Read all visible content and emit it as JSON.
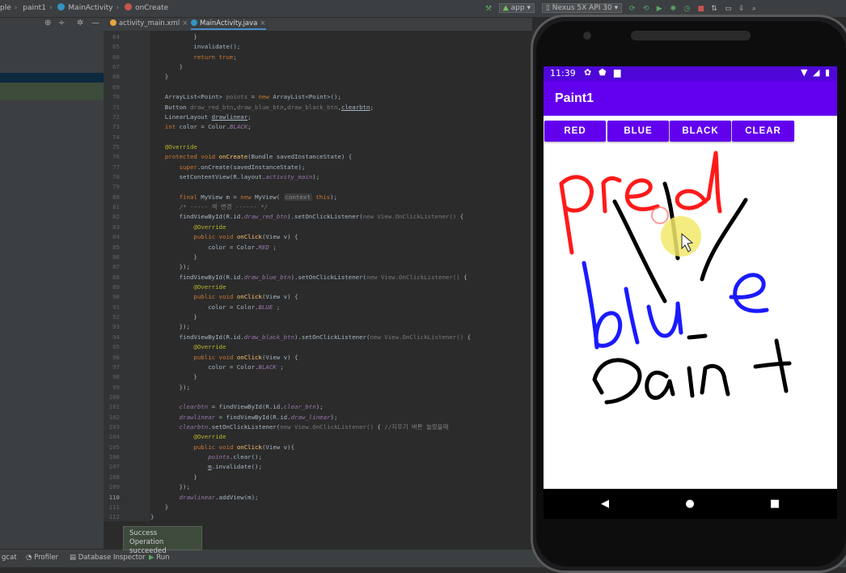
{
  "breadcrumbs": [
    {
      "label": "ple"
    },
    {
      "label": "paint1"
    },
    {
      "label": "MainActivity"
    },
    {
      "label": "onCreate"
    }
  ],
  "toolbar": {
    "run_config": "app",
    "device": "Nexus 5X API 30"
  },
  "tabs": [
    {
      "label": "activity_main.xml"
    },
    {
      "label": "MainActivity.java"
    }
  ],
  "code_lines": [
    {
      "n": "64",
      "html": "            }"
    },
    {
      "n": "65",
      "html": "            invalidate();"
    },
    {
      "n": "66",
      "html": "            <span class=\"kw\">return true</span>;"
    },
    {
      "n": "67",
      "html": "        }"
    },
    {
      "n": "68",
      "html": "    }"
    },
    {
      "n": "69",
      "html": ""
    },
    {
      "n": "70",
      "html": "    ArrayList&lt;Point&gt; <span class=\"gray\">points</span> = <span class=\"kw\">new</span> ArrayList&lt;Point&gt;();"
    },
    {
      "n": "71",
      "html": "    Button <span class=\"gray\">draw_red_btn</span>,<span class=\"gray\">draw_blue_btn</span>,<span class=\"gray\">draw_black_btn</span>,<span class=\"ul\">clearbtn</span>;"
    },
    {
      "n": "72",
      "html": "    LinearLayout <span class=\"ul\">drawlinear</span>;"
    },
    {
      "n": "73",
      "html": "    <span class=\"kw\">int</span> color = Color.<span class=\"it\">BLACK</span>;"
    },
    {
      "n": "74",
      "html": ""
    },
    {
      "n": "75",
      "html": "    <span class=\"ann\">@Override</span>"
    },
    {
      "n": "76",
      "html": "    <span class=\"kw\">protected void</span> <span class=\"fn\">onCreate</span>(Bundle savedInstanceState) {"
    },
    {
      "n": "77",
      "html": "        <span class=\"kw\">super</span>.onCreate(savedInstanceState);"
    },
    {
      "n": "78",
      "html": "        setContentView(R.layout.<span class=\"it\">activity_main</span>);"
    },
    {
      "n": "79",
      "html": ""
    },
    {
      "n": "80",
      "html": "        <span class=\"kw\">final</span> MyView m = <span class=\"kw\">new</span> MyView( <span class=\"hint\">context</span> <span class=\"kw\">this</span>);"
    },
    {
      "n": "81",
      "html": "        <span class=\"cm\">/* ----- 색 변경 ------ */</span>"
    },
    {
      "n": "82",
      "html": "        findViewById(R.id.<span class=\"it\">draw_red_btn</span>).setOnClickListener(<span class=\"gray\">new View.OnClickListener()</span> {"
    },
    {
      "n": "83",
      "html": "            <span class=\"ann\">@Override</span>"
    },
    {
      "n": "84",
      "html": "            <span class=\"kw\">public void</span> <span class=\"fn\">onClick</span>(View v) {"
    },
    {
      "n": "85",
      "html": "                color = Color.<span class=\"it\">RED</span> ;"
    },
    {
      "n": "86",
      "html": "            }"
    },
    {
      "n": "87",
      "html": "        });"
    },
    {
      "n": "88",
      "html": "        findViewById(R.id.<span class=\"it\">draw_blue_btn</span>).setOnClickListener(<span class=\"gray\">new View.OnClickListener()</span> {"
    },
    {
      "n": "89",
      "html": "            <span class=\"ann\">@Override</span>"
    },
    {
      "n": "90",
      "html": "            <span class=\"kw\">public void</span> <span class=\"fn\">onClick</span>(View v) {"
    },
    {
      "n": "91",
      "html": "                color = Color.<span class=\"it\">BLUE</span> ;"
    },
    {
      "n": "92",
      "html": "            }"
    },
    {
      "n": "93",
      "html": "        });"
    },
    {
      "n": "94",
      "html": "        findViewById(R.id.<span class=\"it\">draw_black_btn</span>).setOnClickListener(<span class=\"gray\">new View.OnClickListener()</span> {"
    },
    {
      "n": "95",
      "html": "            <span class=\"ann\">@Override</span>"
    },
    {
      "n": "96",
      "html": "            <span class=\"kw\">public void</span> <span class=\"fn\">onClick</span>(View v) {"
    },
    {
      "n": "97",
      "html": "                color = Color.<span class=\"it\">BLACK</span> ;"
    },
    {
      "n": "98",
      "html": "            }"
    },
    {
      "n": "99",
      "html": "        });"
    },
    {
      "n": "100",
      "html": ""
    },
    {
      "n": "101",
      "html": "        <span class=\"it\">clearbtn</span> = findViewById(R.id.<span class=\"it\">clear_btn</span>);"
    },
    {
      "n": "102",
      "html": "        <span class=\"it\">drawlinear</span> = findViewById(R.id.<span class=\"it\">draw_linear</span>);"
    },
    {
      "n": "103",
      "html": "        <span class=\"it\">clearbtn</span>.setOnClickListener(<span class=\"gray\">new View.OnClickListener()</span> { <span class=\"cm\">//지우기 버튼 눌렀을때</span>"
    },
    {
      "n": "104",
      "html": "            <span class=\"ann\">@Override</span>"
    },
    {
      "n": "105",
      "html": "            <span class=\"kw\">public void</span> <span class=\"fn\">onClick</span>(View v){"
    },
    {
      "n": "106",
      "html": "                <span class=\"it\">points</span>.clear();"
    },
    {
      "n": "107",
      "html": "                <span class=\"ul\">m</span>.invalidate();"
    },
    {
      "n": "108",
      "html": "            }"
    },
    {
      "n": "109",
      "html": "        });"
    },
    {
      "n": "110",
      "html": "        <span class=\"it\">drawlinear</span>.addView(m);"
    },
    {
      "n": "111",
      "html": "    }"
    },
    {
      "n": "112",
      "html": "}"
    }
  ],
  "bottom": {
    "items": [
      {
        "label": "gcat"
      },
      {
        "label": "Profiler"
      },
      {
        "label": "Database Inspector"
      },
      {
        "label": "Run"
      }
    ],
    "toast_title": "Success",
    "toast_msg": "Operation succeeded"
  },
  "phone": {
    "time": "11:39",
    "app_title": "Paint1",
    "buttons": [
      {
        "label": "RED"
      },
      {
        "label": "BLUE"
      },
      {
        "label": "BLACK"
      },
      {
        "label": "CLEAR"
      }
    ],
    "colors": {
      "app_bar": "#6200ee",
      "status_bar": "#4f07d8",
      "red": "#ff1a1a",
      "blue": "#1a1aff",
      "black": "#000000"
    }
  }
}
